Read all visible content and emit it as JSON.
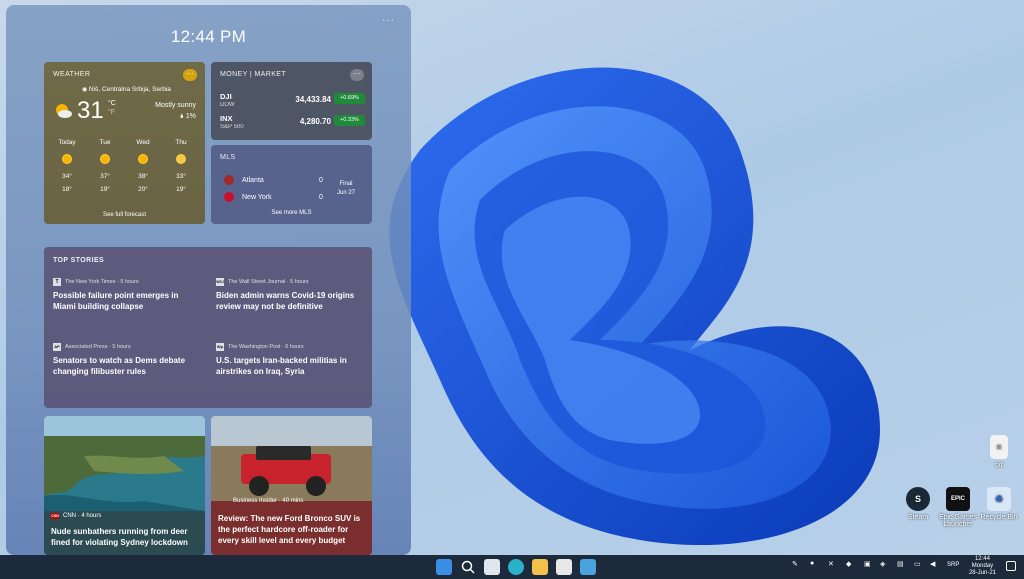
{
  "panel": {
    "time": "12:44 PM",
    "more": "···"
  },
  "weather": {
    "header": "WEATHER",
    "location": "Niš, Centralna Srbija, Serbia",
    "temp": "31",
    "unit_c": "°C",
    "unit_f": "°F",
    "condition": "Mostly sunny",
    "precip": "1%",
    "days": [
      {
        "name": "Today",
        "hi": "34°",
        "lo": "18°"
      },
      {
        "name": "Tue",
        "hi": "37°",
        "lo": "19°"
      },
      {
        "name": "Wed",
        "hi": "38°",
        "lo": "20°"
      },
      {
        "name": "Thu",
        "hi": "33°",
        "lo": "19°"
      }
    ],
    "forecast_link": "See full forecast"
  },
  "market": {
    "header": "MONEY | MARKET",
    "rows": [
      {
        "symbol": "DJI",
        "sub": "DOW",
        "value": "34,433.84",
        "change": "+0.69%"
      },
      {
        "symbol": "INX",
        "sub": "S&P 500",
        "value": "4,280.70",
        "change": "+0.33%"
      }
    ]
  },
  "mls": {
    "header": "MLS",
    "teams": [
      {
        "name": "Atlanta",
        "score": "0"
      },
      {
        "name": "New York",
        "score": "0"
      }
    ],
    "status": "Final",
    "date": "Jun 27",
    "link": "See more MLS"
  },
  "stories": {
    "header": "TOP STORIES",
    "items": [
      {
        "source": "The New York Times · 5 hours",
        "badge": "T",
        "headline": "Possible failure point emerges in Miami building collapse"
      },
      {
        "source": "The Wall Street Journal · 5 hours",
        "badge": "WSJ",
        "headline": "Biden admin warns Covid-19 origins review may not be definitive"
      },
      {
        "source": "Associated Press · 5 hours",
        "badge": "AP",
        "headline": "Senators to watch as Dems debate changing filibuster rules"
      },
      {
        "source": "The Washington Post · 6 hours",
        "badge": "Wp",
        "headline": "U.S. targets Iran-backed militias in airstrikes on Iraq, Syria"
      }
    ]
  },
  "image_cards": [
    {
      "source": "CNN · 4 hours",
      "badge": "CNN",
      "headline": "Nude sunbathers running from deer fined for violating Sydney lockdown"
    },
    {
      "source": "Business Insider · 40 mins",
      "badge": "BI",
      "headline": "Review: The new Ford Bronco SUV is the perfect hardcore off-roader for every skill level and every budget"
    }
  ],
  "desktop_icons": [
    {
      "label": "txt"
    },
    {
      "label": "Steam"
    },
    {
      "label": "Epic Games Launcher"
    },
    {
      "label": "Recycle Bin"
    }
  ],
  "taskbar": {
    "lang": "SRP",
    "time": "12:44",
    "day": "Monday",
    "date": "28-Jun-21"
  }
}
